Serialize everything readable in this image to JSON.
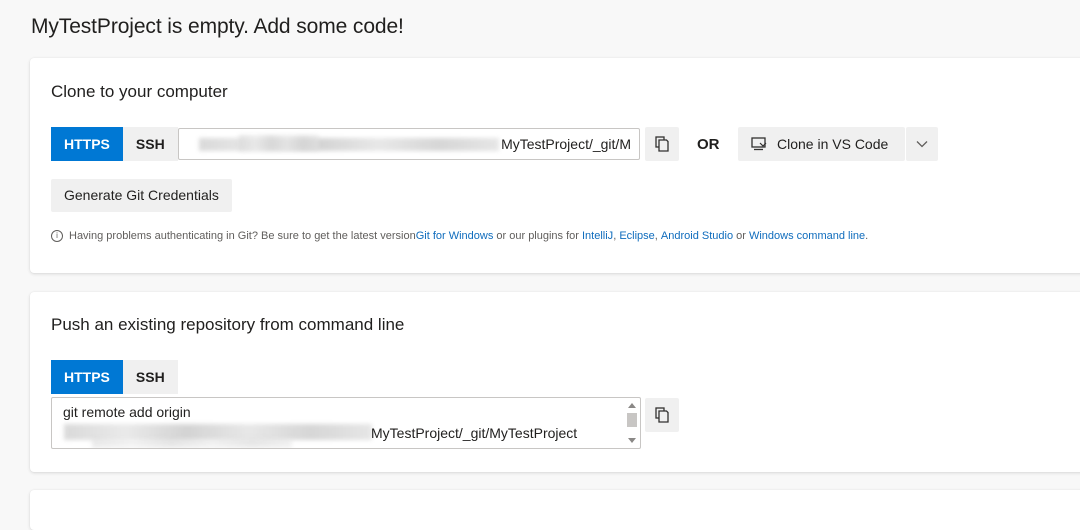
{
  "page": {
    "title": "MyTestProject is empty. Add some code!"
  },
  "clone_section": {
    "title": "Clone to your computer",
    "protocols": [
      "HTTPS",
      "SSH"
    ],
    "selected_protocol": "HTTPS",
    "url_visible_text": "MyTestProject/_git/M",
    "or_label": "OR",
    "clone_vscode_label": "Clone in VS Code",
    "generate_credentials_label": "Generate Git Credentials",
    "help": {
      "info_symbol": "i",
      "prefix": "Having problems authenticating in Git? Be sure to get the latest version ",
      "link_git_windows": "Git for Windows",
      "middle": " or our plugins for ",
      "link_intellij": "IntelliJ",
      "sep1": ", ",
      "link_eclipse": "Eclipse",
      "sep2": ", ",
      "link_android_studio": "Android Studio",
      "sep3": " or ",
      "link_windows_cmd": "Windows command line",
      "suffix": "."
    }
  },
  "push_section": {
    "title": "Push an existing repository from command line",
    "protocols": [
      "HTTPS",
      "SSH"
    ],
    "selected_protocol": "HTTPS",
    "command_line1": "git remote add origin",
    "command_line2_visible": "MyTestProject/_git/MyTestProject"
  },
  "colors": {
    "accent": "#0078d4",
    "link": "#0f6cbd",
    "button_bg": "#f0f0f0",
    "page_bg": "#f8f8f8"
  },
  "icons": [
    "copy-icon",
    "vscode-clone-icon",
    "chevron-down-icon",
    "info-icon"
  ]
}
